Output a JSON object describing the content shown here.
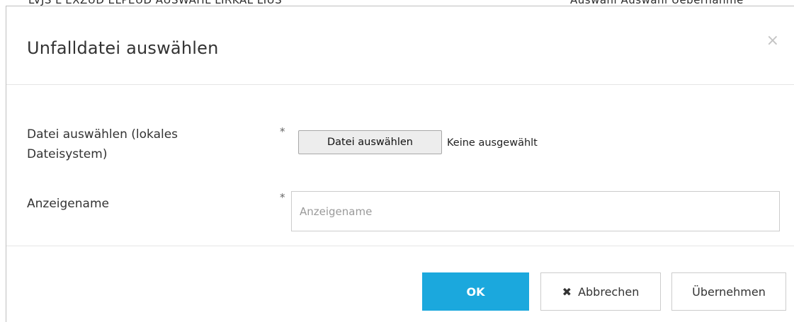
{
  "backdrop": {
    "text_left": "LVJS  L  EXZUD  ELPEUD  AUSWAHL  LIRKAL  LIUS",
    "text_right": "Auswahl  Auswahl  Uebernahme"
  },
  "dialog": {
    "title": "Unfalldatei auswählen",
    "close_symbol": "×"
  },
  "form": {
    "file_field": {
      "label": "Datei auswählen (lokales Dateisystem)",
      "required_marker": "*",
      "button_label": "Datei auswählen",
      "status": "Keine ausgewählt"
    },
    "display_name": {
      "label": "Anzeigename",
      "required_marker": "*",
      "placeholder": "Anzeigename",
      "value": ""
    }
  },
  "footer": {
    "ok_label": "OK",
    "cancel_label": "Abbrechen",
    "cancel_icon": "times-icon",
    "apply_label": "Übernehmen"
  },
  "colors": {
    "primary": "#1ba8dd",
    "border": "#cccccc",
    "text": "#333333"
  }
}
